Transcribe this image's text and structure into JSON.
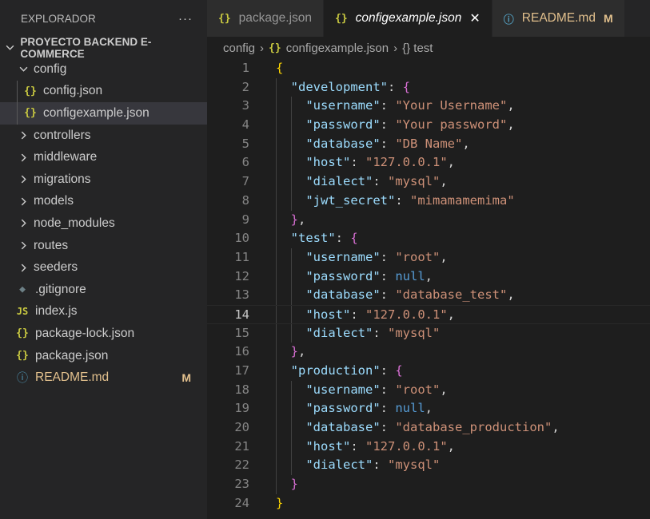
{
  "explorer": {
    "title": "EXPLORADOR",
    "more": "···",
    "project": "PROYECTO BACKEND E-COMMERCE",
    "items": [
      {
        "label": "config",
        "type": "folder-open",
        "depth": 0
      },
      {
        "label": "config.json",
        "type": "json",
        "depth": 1
      },
      {
        "label": "configexample.json",
        "type": "json",
        "depth": 1,
        "active": true
      },
      {
        "label": "controllers",
        "type": "folder",
        "depth": 0
      },
      {
        "label": "middleware",
        "type": "folder",
        "depth": 0
      },
      {
        "label": "migrations",
        "type": "folder",
        "depth": 0
      },
      {
        "label": "models",
        "type": "folder",
        "depth": 0
      },
      {
        "label": "node_modules",
        "type": "folder",
        "depth": 0
      },
      {
        "label": "routes",
        "type": "folder",
        "depth": 0
      },
      {
        "label": "seeders",
        "type": "folder",
        "depth": 0
      },
      {
        "label": ".gitignore",
        "type": "git",
        "depth": 0
      },
      {
        "label": "index.js",
        "type": "js",
        "depth": 0
      },
      {
        "label": "package-lock.json",
        "type": "json",
        "depth": 0
      },
      {
        "label": "package.json",
        "type": "json",
        "depth": 0
      },
      {
        "label": "README.md",
        "type": "info",
        "depth": 0,
        "badge": "M"
      }
    ]
  },
  "tabs": [
    {
      "label": "package.json",
      "icon": "{}",
      "active": false
    },
    {
      "label": "configexample.json",
      "icon": "{}",
      "active": true,
      "close": "✕"
    },
    {
      "label": "README.md",
      "icon": "ⓘ",
      "active": false,
      "badge": "M"
    }
  ],
  "breadcrumb": {
    "folder": "config",
    "file": "configexample.json",
    "symbol": "{} test",
    "sep": "›"
  },
  "editor": {
    "current_line": 14,
    "lines": [
      "{",
      "  \"development\": {",
      "    \"username\": \"Your Username\",",
      "    \"password\": \"Your password\",",
      "    \"database\": \"DB Name\",",
      "    \"host\": \"127.0.0.1\",",
      "    \"dialect\": \"mysql\",",
      "    \"jwt_secret\": \"mimamamemima\"",
      "  },",
      "  \"test\": {",
      "    \"username\": \"root\",",
      "    \"password\": null,",
      "    \"database\": \"database_test\",",
      "    \"host\": \"127.0.0.1\",",
      "    \"dialect\": \"mysql\"",
      "  },",
      "  \"production\": {",
      "    \"username\": \"root\",",
      "    \"password\": null,",
      "    \"database\": \"database_production\",",
      "    \"host\": \"127.0.0.1\",",
      "    \"dialect\": \"mysql\"",
      "  }",
      "}"
    ]
  },
  "colors": {
    "key": "#9cdcfe",
    "string": "#ce9178",
    "keyword": "#569cd6",
    "bracket_outer": "#ffd700",
    "bracket_inner": "#da70d6",
    "modified": "#e2c08d"
  }
}
